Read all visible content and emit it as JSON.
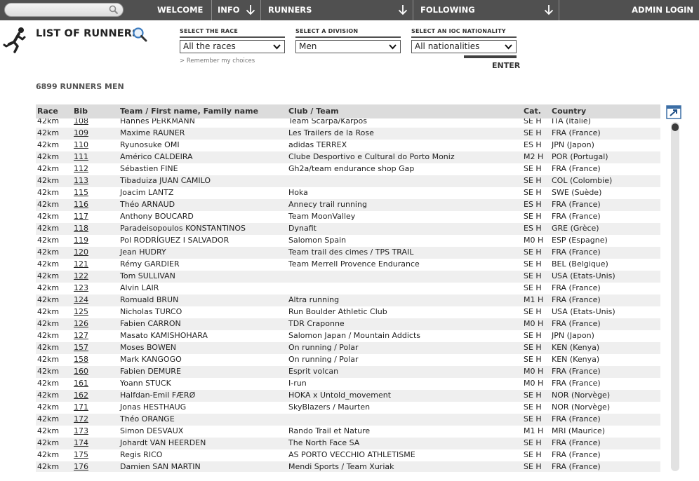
{
  "nav": {
    "search_placeholder": "",
    "welcome": "WELCOME",
    "info": "INFO",
    "runners": "RUNNERS",
    "following": "FOLLOWING",
    "admin_login": "ADMIN LOGIN"
  },
  "header": {
    "title": "LIST OF RUNNERS",
    "remember": "> Remember my choices",
    "enter": "ENTER",
    "count": "6899 RUNNERS MEN"
  },
  "filters": {
    "race": {
      "label": "SELECT THE RACE",
      "value": "All the races"
    },
    "division": {
      "label": "SELECT A DIVISION",
      "value": "Men"
    },
    "nationality": {
      "label": "SELECT AN IOC NATIONALITY",
      "value": "All nationalities"
    }
  },
  "table": {
    "headers": {
      "race": "Race",
      "bib": "Bib",
      "name": "Team / First name, Family name",
      "club": "Club / Team",
      "cat": "Cat.",
      "country": "Country"
    },
    "rows": [
      {
        "race": "42km",
        "bib": "108",
        "name": "Hannes PERKMANN",
        "club": "Team Scarpa/Karpos",
        "cat": "SE H",
        "country": "ITA (Italie)"
      },
      {
        "race": "42km",
        "bib": "109",
        "name": "Maxime RAUNER",
        "club": "Les Trailers de la Rose",
        "cat": "SE H",
        "country": "FRA (France)"
      },
      {
        "race": "42km",
        "bib": "110",
        "name": "Ryunosuke OMI",
        "club": "adidas TERREX",
        "cat": "ES H",
        "country": "JPN (Japon)"
      },
      {
        "race": "42km",
        "bib": "111",
        "name": "Américo CALDEIRA",
        "club": "Clube Desportivo e Cultural do Porto Moniz",
        "cat": "M2 H",
        "country": "POR (Portugal)"
      },
      {
        "race": "42km",
        "bib": "112",
        "name": "Sébastien FINE",
        "club": "Gh2a/team endurance shop Gap",
        "cat": "SE H",
        "country": "FRA (France)"
      },
      {
        "race": "42km",
        "bib": "113",
        "name": "Tibaduiza JUAN CAMILO",
        "club": "",
        "cat": "SE H",
        "country": "COL (Colombie)"
      },
      {
        "race": "42km",
        "bib": "115",
        "name": "Joacim LANTZ",
        "club": "Hoka",
        "cat": "SE H",
        "country": "SWE (Suède)"
      },
      {
        "race": "42km",
        "bib": "116",
        "name": "Théo ARNAUD",
        "club": "Annecy trail running",
        "cat": "ES H",
        "country": "FRA (France)"
      },
      {
        "race": "42km",
        "bib": "117",
        "name": "Anthony BOUCARD",
        "club": "Team MoonValley",
        "cat": "SE H",
        "country": "FRA (France)"
      },
      {
        "race": "42km",
        "bib": "118",
        "name": "Paradeisopoulos KONSTANTINOS",
        "club": "Dynafit",
        "cat": "ES H",
        "country": "GRE (Grèce)"
      },
      {
        "race": "42km",
        "bib": "119",
        "name": "Pol RODRÍGUEZ I SALVADOR",
        "club": "Salomon Spain",
        "cat": "M0 H",
        "country": "ESP (Espagne)"
      },
      {
        "race": "42km",
        "bib": "120",
        "name": "Jean HUDRY",
        "club": "Team trail des cimes / TPS TRAIL",
        "cat": "SE H",
        "country": "FRA (France)"
      },
      {
        "race": "42km",
        "bib": "121",
        "name": "Rémy GARDIER",
        "club": "Team Merrell Provence Endurance",
        "cat": "SE H",
        "country": "BEL (Belgique)"
      },
      {
        "race": "42km",
        "bib": "122",
        "name": "Tom SULLIVAN",
        "club": "",
        "cat": "SE H",
        "country": "USA (Etats-Unis)"
      },
      {
        "race": "42km",
        "bib": "123",
        "name": "Alvin LAIR",
        "club": "",
        "cat": "SE H",
        "country": "FRA (France)"
      },
      {
        "race": "42km",
        "bib": "124",
        "name": "Romuald BRUN",
        "club": "Altra running",
        "cat": "M1 H",
        "country": "FRA (France)"
      },
      {
        "race": "42km",
        "bib": "125",
        "name": "Nicholas TURCO",
        "club": "Run Boulder Athletic Club",
        "cat": "SE H",
        "country": "USA (Etats-Unis)"
      },
      {
        "race": "42km",
        "bib": "126",
        "name": "Fabien CARRON",
        "club": "TDR Craponne",
        "cat": "M0 H",
        "country": "FRA (France)"
      },
      {
        "race": "42km",
        "bib": "127",
        "name": "Masato KAMISHOHARA",
        "club": "Salomon Japan / Mountain Addicts",
        "cat": "SE H",
        "country": "JPN (Japon)"
      },
      {
        "race": "42km",
        "bib": "157",
        "name": "Moses BOWEN",
        "club": "On running / Polar",
        "cat": "SE H",
        "country": "KEN (Kenya)"
      },
      {
        "race": "42km",
        "bib": "158",
        "name": "Mark KANGOGO",
        "club": "On running / Polar",
        "cat": "SE H",
        "country": "KEN (Kenya)"
      },
      {
        "race": "42km",
        "bib": "160",
        "name": "Fabien DEMURE",
        "club": "Esprit volcan",
        "cat": "M0 H",
        "country": "FRA (France)"
      },
      {
        "race": "42km",
        "bib": "161",
        "name": "Yoann STUCK",
        "club": "I-run",
        "cat": "M0 H",
        "country": "FRA (France)"
      },
      {
        "race": "42km",
        "bib": "162",
        "name": "Halfdan-Emil FÆRØ",
        "club": "HOKA x Untold_movement",
        "cat": "SE H",
        "country": "NOR (Norvège)"
      },
      {
        "race": "42km",
        "bib": "171",
        "name": "Jonas HESTHAUG",
        "club": "SkyBlazers / Maurten",
        "cat": "SE H",
        "country": "NOR (Norvège)"
      },
      {
        "race": "42km",
        "bib": "172",
        "name": "Théo ORANGE",
        "club": "",
        "cat": "SE H",
        "country": "FRA (France)"
      },
      {
        "race": "42km",
        "bib": "173",
        "name": "Simon DESVAUX",
        "club": "Rando Trail et Nature",
        "cat": "M1 H",
        "country": "MRI (Maurice)"
      },
      {
        "race": "42km",
        "bib": "174",
        "name": "Johardt VAN HEERDEN",
        "club": "The North Face SA",
        "cat": "SE H",
        "country": "FRA (France)"
      },
      {
        "race": "42km",
        "bib": "175",
        "name": "Regis RICO",
        "club": "AS PORTO VECCHIO ATHLETISME",
        "cat": "SE H",
        "country": "FRA (France)"
      },
      {
        "race": "42km",
        "bib": "176",
        "name": "Damien SAN MARTIN",
        "club": "Mendi Sports / Team Xuriak",
        "cat": "SE H",
        "country": "FRA (France)"
      }
    ]
  },
  "icons": {
    "search": "search-icon",
    "nav_arrow": "arrow-down-icon",
    "logo": "runner-icon",
    "title_search": "magnifier-icon",
    "export": "export-icon",
    "dropdown": "chevron-down-icon"
  },
  "colors": {
    "nav_bg": "#505050",
    "header_row_bg": "#dcdcdc",
    "zebra_row_bg": "#efefef",
    "magnifier_blue": "#3b7bbf"
  }
}
